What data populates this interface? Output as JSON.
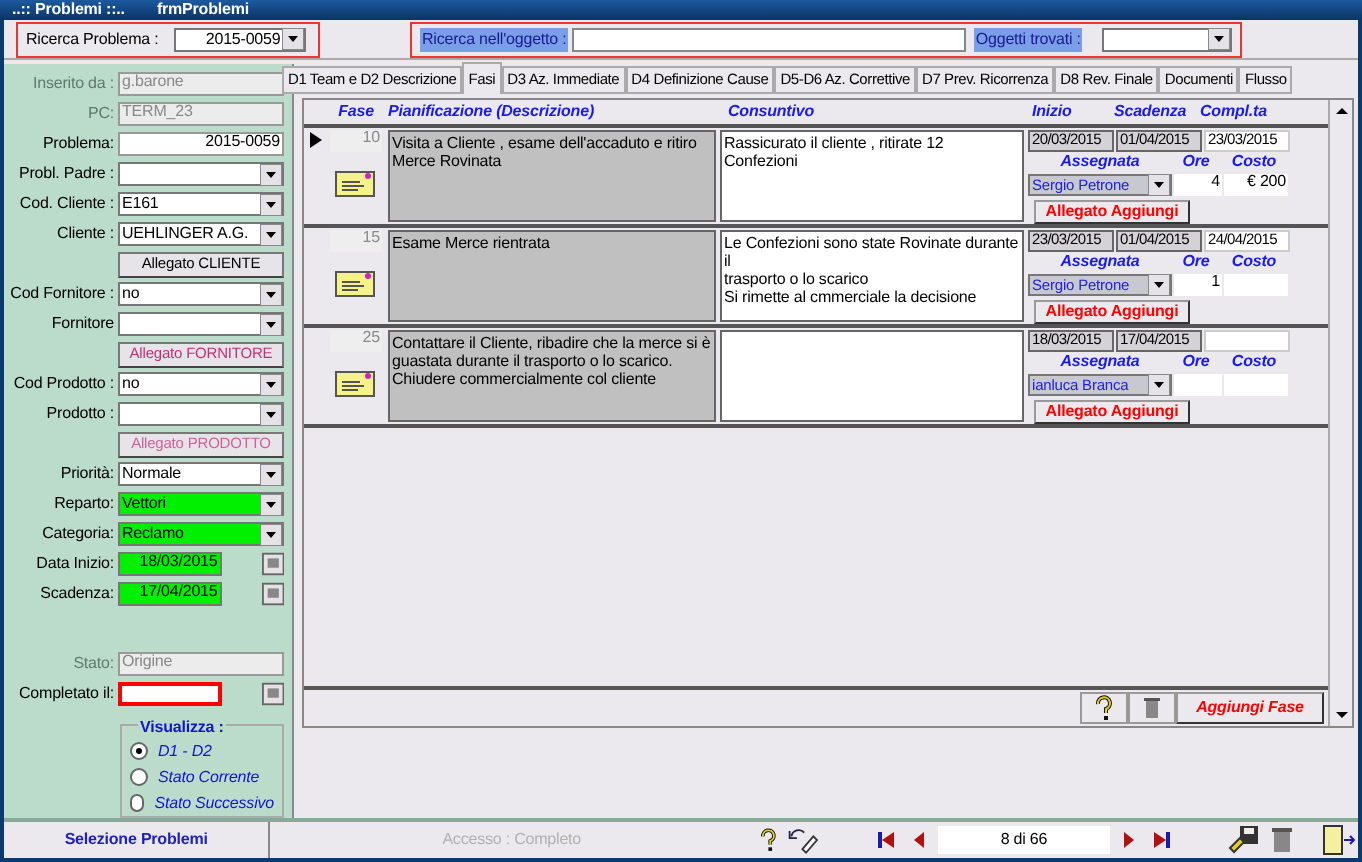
{
  "window": {
    "title": "..:: Problemi ::..",
    "form_name": "frmProblemi"
  },
  "problem_search": {
    "label": "Ricerca Problema :",
    "value": "2015-0059"
  },
  "object_search": {
    "label": "Ricerca nell'oggetto :",
    "found_label": "Oggetti trovati :"
  },
  "left_panel": {
    "groups": [
      [
        {
          "kind": "text",
          "label": "Inserito da :",
          "value": "g.barone",
          "disabled": true,
          "highlighted": false
        },
        {
          "kind": "text",
          "label": "PC:",
          "value": "TERM_23",
          "disabled": true,
          "highlighted": false
        },
        {
          "kind": "id",
          "label": "Problema:",
          "value": "2015-0059",
          "disabled": false,
          "highlighted": false
        },
        {
          "kind": "combo",
          "label": "Probl. Padre :",
          "disabled": false,
          "highlighted": false
        },
        {
          "kind": "combo",
          "label": "Cod. Cliente :",
          "value": "E161",
          "disabled": false,
          "highlighted": false
        },
        {
          "kind": "combo",
          "label": "Cliente :",
          "value": "UEHLINGER A.G.",
          "disabled": false,
          "highlighted": false
        },
        {
          "kind": "button",
          "value": "Allegato CLIENTE",
          "disabled": false,
          "emphasis": false
        },
        {
          "kind": "combo",
          "label": "Cod Fornitore :",
          "value": "no",
          "disabled": false,
          "highlighted": false
        },
        {
          "kind": "combo",
          "label": "Fornitore",
          "disabled": false,
          "highlighted": false
        },
        {
          "kind": "button",
          "value": "Allegato FORNITORE",
          "disabled": false,
          "emphasis": true
        },
        {
          "kind": "combo",
          "label": "Cod Prodotto :",
          "value": "no",
          "disabled": false,
          "highlighted": false
        },
        {
          "kind": "combo",
          "label": "Prodotto :",
          "disabled": false,
          "highlighted": false
        },
        {
          "kind": "button",
          "value": "Allegato PRODOTTO",
          "disabled": true,
          "emphasis": true
        },
        {
          "kind": "combo",
          "label": "Priorità:",
          "value": "Normale",
          "disabled": false,
          "highlighted": false
        },
        {
          "kind": "combo",
          "label": "Reparto:",
          "value": "Vettori",
          "disabled": false,
          "highlighted": true
        },
        {
          "kind": "combo",
          "label": "Categoria:",
          "value": "Reclamo",
          "disabled": false,
          "highlighted": true
        },
        {
          "kind": "date",
          "label": "Data Inizio:",
          "value": "18/03/2015",
          "disabled": false,
          "highlighted": true,
          "required": false
        },
        {
          "kind": "date",
          "label": "Scadenza:",
          "value": "17/04/2015",
          "disabled": false,
          "highlighted": true,
          "required": false
        }
      ],
      [
        {
          "kind": "text",
          "label": "Stato:",
          "value": "Origine",
          "disabled": true,
          "highlighted": false
        },
        {
          "kind": "date",
          "label": "Completato il:",
          "disabled": false,
          "highlighted": false,
          "required": true
        }
      ]
    ],
    "view": {
      "title": "Visualizza :",
      "options": [
        {
          "label": "D1 - D2",
          "selected": true
        },
        {
          "label": "Stato Corrente",
          "selected": false
        },
        {
          "label": "Stato Successivo",
          "selected": false
        }
      ]
    }
  },
  "tabs": [
    {
      "label": "D1 Team e D2 Descrizione",
      "selected": false
    },
    {
      "label": "Fasi",
      "selected": true
    },
    {
      "label": "D3 Az. Immediate",
      "selected": false
    },
    {
      "label": "D4 Definizione Cause",
      "selected": false
    },
    {
      "label": "D5-D6 Az. Correttive",
      "selected": false
    },
    {
      "label": "D7 Prev. Ricorrenza",
      "selected": false
    },
    {
      "label": "D8 Rev. Finale",
      "selected": false
    },
    {
      "label": "Documenti",
      "selected": false
    },
    {
      "label": "Flusso",
      "selected": false
    }
  ],
  "phases": {
    "columns": [
      "Fase",
      "Pianificazione (Descrizione)",
      "Consuntivo",
      "Inizio",
      "Scadenza",
      "Compl.ta"
    ],
    "rows": [
      {
        "selected": true,
        "fase": "10",
        "description": "Visita a Cliente , esame dell'accaduto e ritiro\nMerce Rovinata",
        "consuntivo": "Rassicurato il cliente , ritirate  12 Confezioni",
        "inizio": "20/03/2015",
        "scadenza": "01/04/2015",
        "completata": "23/03/2015",
        "sub_headers": [
          "Assegnata",
          "Ore",
          "Costo"
        ],
        "assegnata": "Sergio Petrone",
        "ore": "4",
        "costo": "€ 200",
        "attach_button": "Allegato Aggiungi"
      },
      {
        "selected": false,
        "fase": "15",
        "description": "Esame Merce rientrata",
        "consuntivo": "Le Confezioni  sono state Rovinate durante il\ntrasporto o lo scarico\nSi rimette al cmmerciale la decisione",
        "inizio": "23/03/2015",
        "scadenza": "01/04/2015",
        "completata": "24/04/2015",
        "sub_headers": [
          "Assegnata",
          "Ore",
          "Costo"
        ],
        "assegnata": "Sergio Petrone",
        "ore": "1",
        "attach_button": "Allegato Aggiungi"
      },
      {
        "selected": false,
        "fase": "25",
        "description": "Contattare il Cliente, ribadire che la merce si è\nguastata durante il trasporto o lo scarico.\nChiudere commercialmente col cliente",
        "inizio": "18/03/2015",
        "scadenza": "17/04/2015",
        "sub_headers": [
          "Assegnata",
          "Ore",
          "Costo"
        ],
        "assegnata": "ianluca Branca",
        "attach_button": "Allegato Aggiungi"
      }
    ],
    "add_button": "Aggiungi Fase"
  },
  "bottom_bar": {
    "select_button": "Selezione Problemi",
    "access": "Accesso : Completo",
    "record": "8 di 66"
  }
}
